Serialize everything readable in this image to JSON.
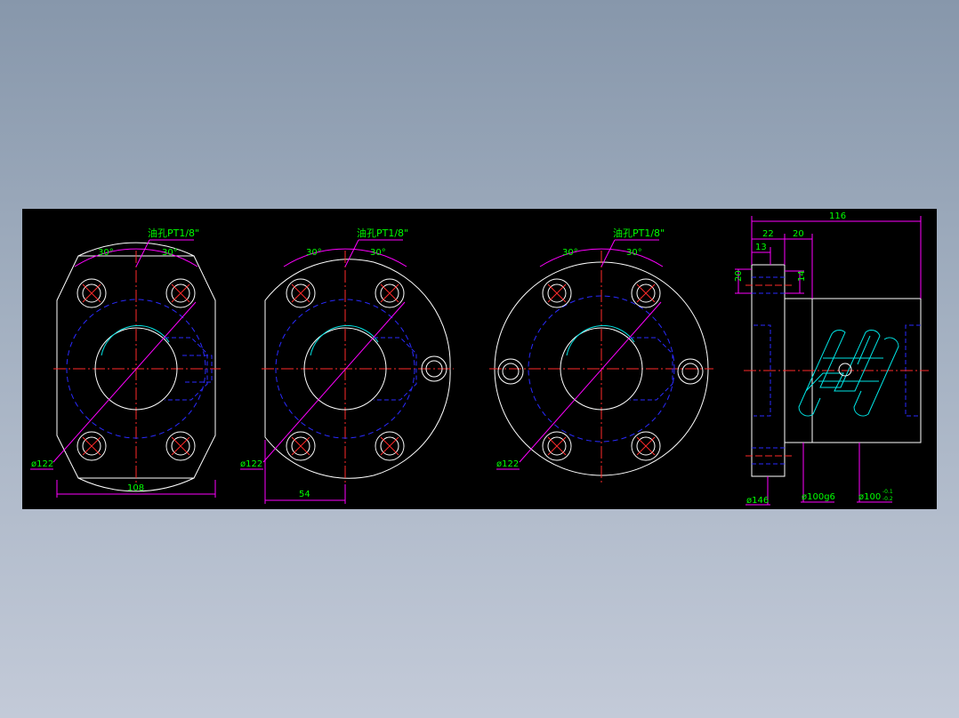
{
  "colors": {
    "background": "#8797ab",
    "drawing_area": "#000000",
    "outline": "#ffffff",
    "centerline": "#ff2a2a",
    "hidden_line": "#2a2aff",
    "dimension": "#ff00ff",
    "dimension_text": "#00ff00",
    "thread": "#00e5e5"
  },
  "views": {
    "flange_a": {
      "angle_left": "30°",
      "angle_right": "30°",
      "oil_hole": "油孔PT1/8\"",
      "bolt_circle": "ø122",
      "width": "108"
    },
    "flange_b": {
      "angle_left": "30°",
      "angle_right": "30°",
      "oil_hole": "油孔PT1/8\"",
      "bolt_circle": "ø122",
      "offset": "54"
    },
    "flange_c": {
      "angle_left": "30°",
      "angle_right": "30°",
      "oil_hole": "油孔PT1/8\"",
      "bolt_circle": "ø122"
    },
    "side": {
      "length": "116",
      "flange_thickness": "22",
      "step": "20",
      "hole_offset": "13",
      "hole_height": "20",
      "counterbore": "14",
      "flange_dia": "ø146",
      "body_dia": "ø100g6",
      "nut_dia": "ø100",
      "tol_upper": "-0.1",
      "tol_lower": "-0.2"
    }
  }
}
